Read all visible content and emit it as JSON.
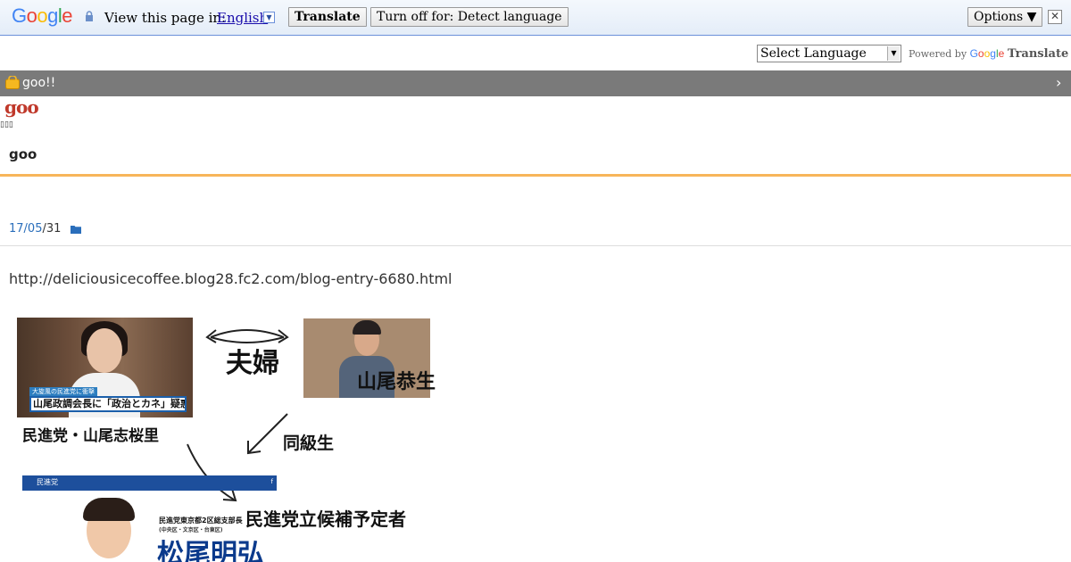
{
  "translate_bar": {
    "logo_letters": [
      {
        "ch": "G",
        "color": "#4285f4"
      },
      {
        "ch": "o",
        "color": "#ea4335"
      },
      {
        "ch": "o",
        "color": "#fbbc05"
      },
      {
        "ch": "g",
        "color": "#4285f4"
      },
      {
        "ch": "l",
        "color": "#34a853"
      },
      {
        "ch": "e",
        "color": "#ea4335"
      }
    ],
    "view_in_label": "View this page in:",
    "language": "English",
    "translate_button": "Translate",
    "turn_off_button": "Turn off for: Detect language",
    "options_button": "Options ▼",
    "close_glyph": "✕"
  },
  "language_row": {
    "select_value": "Select Language",
    "powered_by": "Powered by",
    "google_word": "Google",
    "translate_word": "Translate"
  },
  "blog_bar": {
    "label": "goo!!",
    "chevron": "›"
  },
  "header": {
    "logo_text": "goo",
    "tofu_text": "▯▯▯",
    "site_title": "goo"
  },
  "post": {
    "date_link": "17/05",
    "date_rest": "/31",
    "source_url": "http://deliciousicecoffee.blog28.fc2.com/blog-entry-6680.html"
  },
  "image_texts": {
    "fufu": "夫婦",
    "yamao_takao": "山尾恭生",
    "minshin_yamao": "民進党・山尾志桜里",
    "doukyuusei": "同級生",
    "news_tag": "大旋風の民進党に衝撃",
    "news_headline": "山尾政調会長に「政治とカネ」疑惑報道",
    "banner_label": "民進党",
    "banner_fb": "f",
    "branch_title": "民進党東京都2区総支部長",
    "branch_area": "(中央区・文京区・台東区)",
    "candidate_label": "民進党立候補予定者",
    "candidate_name": "松尾明弘"
  },
  "colors": {
    "orange_rule": "#f7b55a",
    "blog_bar": "#7a7a7a",
    "link_blue": "#2a6ebb",
    "logo_red": "#c0392b"
  }
}
